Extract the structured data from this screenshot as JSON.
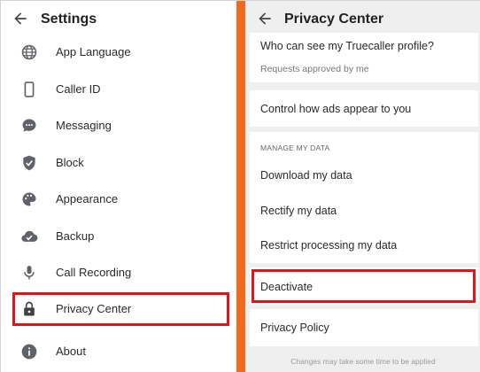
{
  "settings": {
    "title": "Settings",
    "items": [
      {
        "label": "App Language",
        "icon": "globe-icon"
      },
      {
        "label": "Caller ID",
        "icon": "phone-icon"
      },
      {
        "label": "Messaging",
        "icon": "chat-bubble-icon"
      },
      {
        "label": "Block",
        "icon": "shield-check-icon"
      },
      {
        "label": "Appearance",
        "icon": "palette-icon"
      },
      {
        "label": "Backup",
        "icon": "cloud-check-icon"
      },
      {
        "label": "Call Recording",
        "icon": "microphone-icon"
      },
      {
        "label": "Privacy Center",
        "icon": "lock-icon",
        "highlighted": true
      },
      {
        "label": "About",
        "icon": "info-icon"
      }
    ]
  },
  "privacy": {
    "title": "Privacy Center",
    "profile_visibility": {
      "question": "Who can see my Truecaller profile?",
      "value": "Requests approved by me"
    },
    "ads": {
      "label": "Control how ads appear to you"
    },
    "manage_data": {
      "caption": "MANAGE MY DATA",
      "items": [
        {
          "label": "Download my data"
        },
        {
          "label": "Rectify my data"
        },
        {
          "label": "Restrict processing my data"
        }
      ]
    },
    "deactivate": {
      "label": "Deactivate",
      "highlighted": true
    },
    "policy": {
      "label": "Privacy Policy"
    },
    "footnote": "Changes may take some time to be applied"
  },
  "colors": {
    "accent_divider": "#f26a1b",
    "highlight_box": "#e0141b",
    "icon_gray": "#5f6368"
  }
}
